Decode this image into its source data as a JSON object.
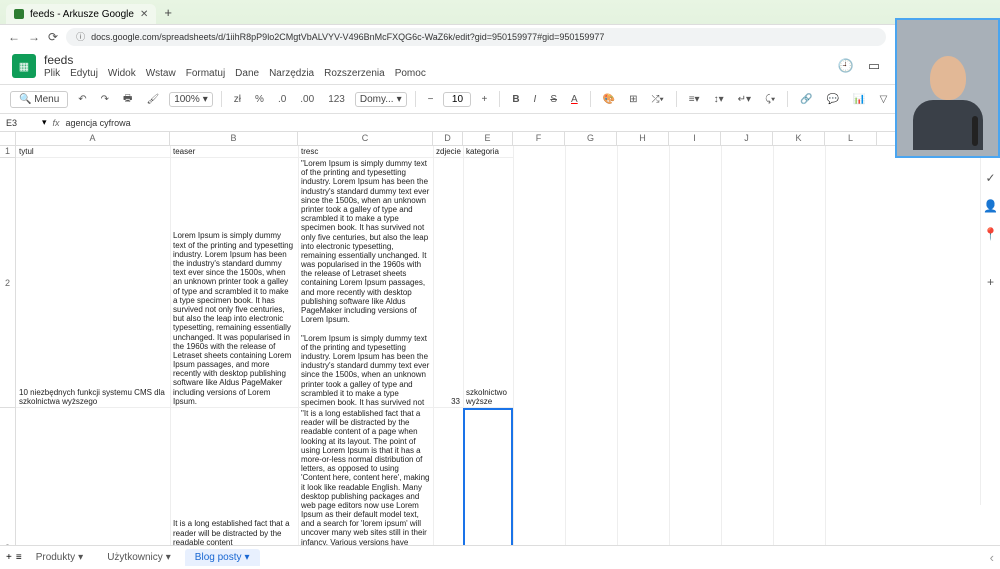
{
  "browser": {
    "tab_title": "feeds - Arkusze Google",
    "url": "docs.google.com/spreadsheets/d/1iihR8pP9lo2CMgtVbALVYV-V496BnMcFXQG6c-WaZ6k/edit?gid=950159977#gid=950159977"
  },
  "doc": {
    "name": "feeds",
    "menus": [
      "Plik",
      "Edytuj",
      "Widok",
      "Wstaw",
      "Formatuj",
      "Dane",
      "Narzędzia",
      "Rozszerzenia",
      "Pomoc"
    ]
  },
  "toolbar": {
    "menu_label": "Menu",
    "zoom": "100%",
    "currency": "zł",
    "percent": "%",
    "font": "Domy...",
    "size": "10"
  },
  "formula": {
    "cell": "E3",
    "value": "agencja cyfrowa"
  },
  "columns": [
    "A",
    "B",
    "C",
    "D",
    "E",
    "F",
    "G",
    "H",
    "I",
    "J",
    "K",
    "L"
  ],
  "headers": {
    "A": "tytul",
    "B": "teaser",
    "C": "tresc",
    "D": "zdjecie",
    "E": "kategoria"
  },
  "row2": {
    "A": "10 niezbędnych funkcji systemu CMS dla szkolnictwa wyższego",
    "B": "Lorem Ipsum is simply dummy text of the printing and typesetting industry. Lorem Ipsum has been the industry's standard dummy text ever since the 1500s, when an unknown printer took a galley of type and scrambled it to make a type specimen book. It has survived not only five centuries, but also the leap into electronic typesetting, remaining essentially unchanged. It was popularised in the 1960s with the release of Letraset sheets containing Lorem Ipsum passages, and more recently with desktop publishing software like Aldus PageMaker including versions of Lorem Ipsum.",
    "C": "\"Lorem Ipsum is simply dummy text of the printing and typesetting industry. Lorem Ipsum has been the industry's standard dummy text ever since the 1500s, when an unknown printer took a galley of type and scrambled it to make a type specimen book. It has survived not only five centuries, but also the leap into electronic typesetting, remaining essentially unchanged. It was popularised in the 1960s with the release of Letraset sheets containing Lorem Ipsum passages, and more recently with desktop publishing software like Aldus PageMaker including versions of Lorem Ipsum.\n\n\"Lorem Ipsum is simply dummy text of the printing and typesetting industry. Lorem Ipsum has been the industry's standard dummy text ever since the 1500s, when an unknown printer took a galley of type and scrambled it to make a type specimen book. It has survived not only five centuries, but also the leap into electronic typesetting, remaining essentially unchanged. It was popularised in the 1960s with the release of Letraset sheets containing Lorem Ipsum passages, and more recently with desktop publishing software like Aldus PageMaker including versions of Lorem Ipsum.",
    "D": "33",
    "E": "szkolnictwo wyższe"
  },
  "row3": {
    "B": "It is a long established fact that a reader will be distracted by the readable content",
    "C": "\"It is a long established fact that a reader will be distracted by the readable content of a page when looking at its layout. The point of using Lorem Ipsum is that it has a more-or-less normal distribution of letters, as opposed to using 'Content here, content here', making it look like readable English. Many desktop publishing packages and web page editors now use Lorem Ipsum as their default model text, and a search for 'lorem ipsum' will uncover many web sites still in their infancy. Various versions have evolved over the years, sometimes by accident, sometimes on purpose (injected humour and the like).\n\n\"It is a long established fact that a reader"
  },
  "sheets": {
    "tabs": [
      "Produkty",
      "Użytkownicy",
      "Blog posty"
    ],
    "active": 2
  }
}
